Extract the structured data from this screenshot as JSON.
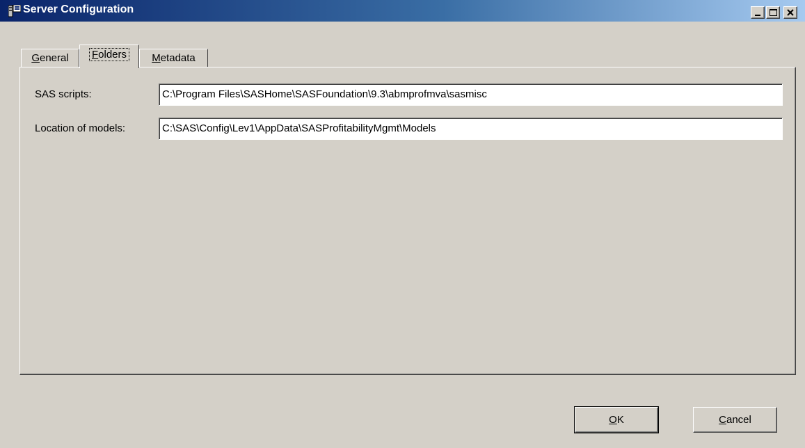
{
  "window": {
    "title": "Server Configuration",
    "icon": "server-config-icon",
    "controls": [
      "minimize-icon",
      "maximize-icon",
      "close-icon"
    ]
  },
  "tabs": [
    {
      "label_pre": "",
      "mnemonic": "G",
      "label_post": "eneral",
      "active": false
    },
    {
      "label_pre": "",
      "mnemonic": "F",
      "label_post": "olders",
      "active": true
    },
    {
      "label_pre": "",
      "mnemonic": "M",
      "label_post": "etadata",
      "active": false
    }
  ],
  "folders": {
    "sas_scripts_label": "SAS scripts:",
    "sas_scripts_value": "C:\\Program Files\\SASHome\\SASFoundation\\9.3\\abmprofmva\\sasmisc",
    "models_label": "Location of models:",
    "models_value": "C:\\SAS\\Config\\Lev1\\AppData\\SASProfitabilityMgmt\\Models"
  },
  "buttons": {
    "ok": {
      "mnemonic": "O",
      "rest": "K"
    },
    "cancel": {
      "mnemonic": "C",
      "rest": "ancel"
    }
  },
  "colors": {
    "titlebar_start": "#0a246a",
    "titlebar_end": "#a6caf0",
    "face": "#d4d0c8"
  }
}
